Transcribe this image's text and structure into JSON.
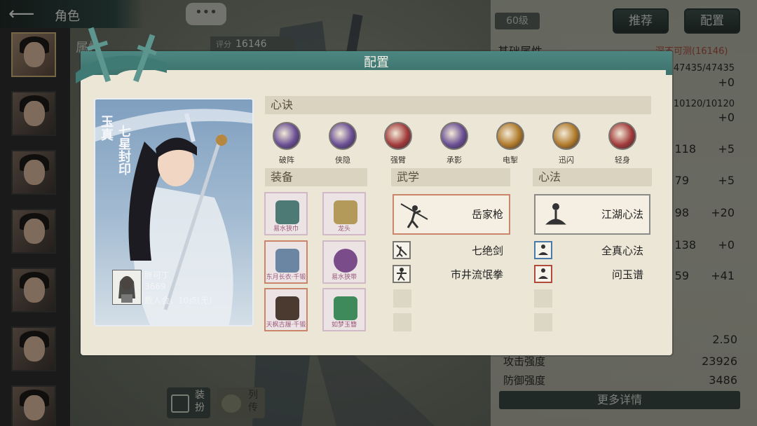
{
  "top": {
    "back_icon": "back-arrow-icon",
    "title": "角色",
    "chat_icon_text": "•••",
    "level": "60级",
    "recommend_label": "推荐",
    "config_label": "配置"
  },
  "background": {
    "score_label": "评分",
    "score_value": "16146",
    "attr_header_left": "属性",
    "attr_header_right": "基础属性",
    "power_note": "深不可测(16146)",
    "stat_rows": [
      {
        "value": "47435/47435"
      },
      {
        "value": "+0"
      },
      {
        "value": "10120/10120"
      },
      {
        "value": "+0"
      },
      {
        "left": "118",
        "value": "+5"
      },
      {
        "left": "79",
        "value": "+5"
      },
      {
        "left": "98",
        "value": "+20"
      },
      {
        "left": "138",
        "value": "+0"
      },
      {
        "left": "59",
        "value": "+41"
      }
    ],
    "crit_value": "2.50",
    "attack_label": "攻击强度",
    "attack_value": "23926",
    "defense_label": "防御强度",
    "defense_value": "3486",
    "more_details": "更多详情",
    "tab_equip": "装扮",
    "tab_bio": "列传"
  },
  "dialog": {
    "title": "配置",
    "card": {
      "name": "玉真",
      "title": "七星封印",
      "player_name": "胖可丁",
      "player_power": "3669",
      "player_guild": "散人会，10点(无)"
    },
    "xinjue_header": "心诀",
    "skills": [
      {
        "label": "破阵",
        "color": "#6a4f94",
        "icon": "purple-rune-icon"
      },
      {
        "label": "侠隐",
        "color": "#6a4f94",
        "icon": "purple-rune-icon"
      },
      {
        "label": "强臂",
        "color": "#a23b3b",
        "icon": "red-rune-icon"
      },
      {
        "label": "承影",
        "color": "#6a4f94",
        "icon": "purple-rune-icon"
      },
      {
        "label": "电掣",
        "color": "#b07a2a",
        "icon": "gold-rune-icon"
      },
      {
        "label": "迅闪",
        "color": "#b07a2a",
        "icon": "gold-rune-icon"
      },
      {
        "label": "轻身",
        "color": "#a23b3b",
        "icon": "red-rune-icon"
      }
    ],
    "equip_header": "装备",
    "equipment": [
      {
        "name": "易水狭巾",
        "icon": "headscarf-icon",
        "color": "#4e7a76"
      },
      {
        "name": "龙头",
        "icon": "whip-chain-icon",
        "color": "#b49a5a"
      },
      {
        "name": "东月长衣·千锻",
        "icon": "robe-icon",
        "color": "#6a86a3"
      },
      {
        "name": "易水狭带",
        "icon": "belt-icon",
        "color": "#7a4c8a"
      },
      {
        "name": "天枫古履·千锻",
        "icon": "shoes-icon",
        "color": "#4a3a30"
      },
      {
        "name": "如梦玉簪",
        "icon": "hairpin-icon",
        "color": "#3f8a5a"
      }
    ],
    "martial_header": "武学",
    "martial_main": "岳家枪",
    "martial_list": [
      "七绝剑",
      "市井流氓拳"
    ],
    "heart_header": "心法",
    "heart_main": "江湖心法",
    "heart_list": [
      "全真心法",
      "问玉谱"
    ]
  }
}
